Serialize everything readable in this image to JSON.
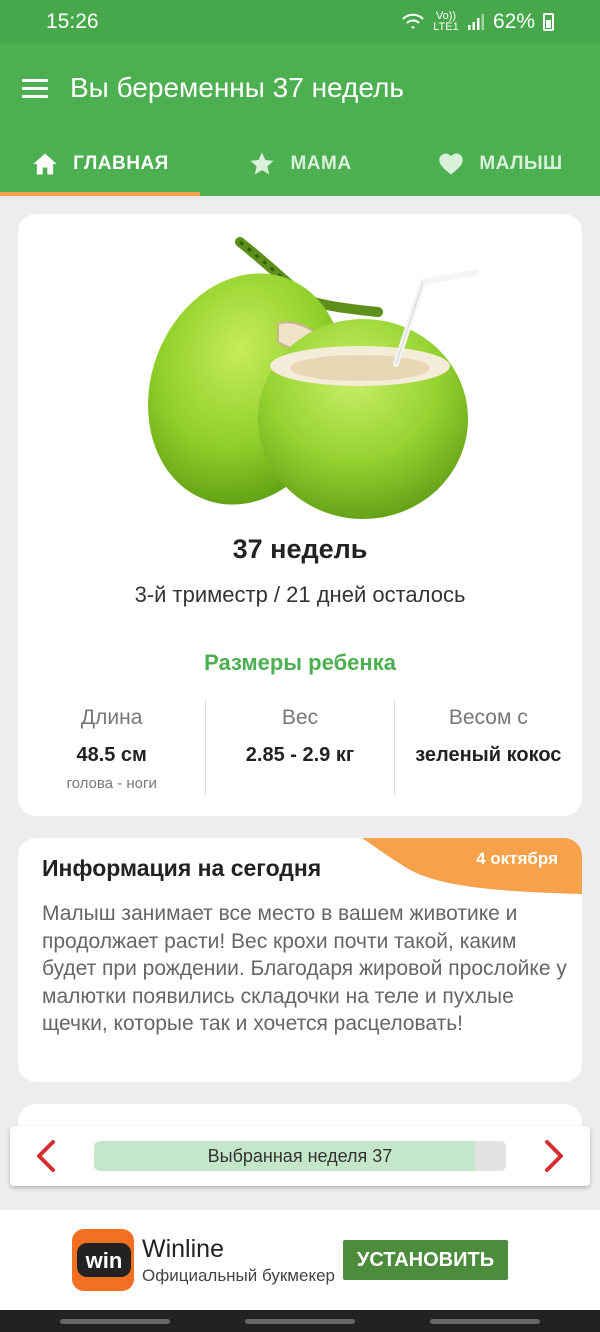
{
  "status": {
    "time": "15:26",
    "network": "Vo)) LTE1",
    "battery": "62%"
  },
  "header": {
    "title": "Вы беременны 37 недель"
  },
  "tabs": [
    {
      "label": "ГЛАВНАЯ",
      "icon": "home-icon",
      "active": true
    },
    {
      "label": "МАМА",
      "icon": "star-icon",
      "active": false
    },
    {
      "label": "МАЛЫШ",
      "icon": "heart-icon",
      "active": false
    }
  ],
  "main_card": {
    "image": "coconut",
    "week": "37 недель",
    "trimester": "3-й триместр / 21 дней осталось",
    "sizes_title": "Размеры ребенка",
    "metrics": [
      {
        "label": "Длина",
        "value": "48.5 см",
        "sub": "голова - ноги"
      },
      {
        "label": "Вес",
        "value": "2.85 - 2.9 кг",
        "sub": ""
      },
      {
        "label": "Весом с",
        "value": "зеленый кокос",
        "sub": ""
      }
    ]
  },
  "info_card": {
    "title": "Информация на сегодня",
    "date": "4 октября",
    "text": "Малыш занимает все место в вашем животике и продолжает расти! Вес крохи почти такой, каким будет при рождении. Благодаря жировой прослойке у малютки появились складочки на теле и пухлые щечки, которые так и хочется расцеловать!"
  },
  "week_selector": {
    "label": "Выбранная неделя 37",
    "progress": 0.925
  },
  "ad": {
    "name": "Winline",
    "description": "Официальный букмекер",
    "button": "УСТАНОВИТЬ",
    "logo_text": "win"
  },
  "colors": {
    "primary": "#4caf50",
    "status_bar": "#46a84a",
    "accent": "#f7a14a",
    "arrow": "#d32f2f",
    "ad_button": "#4c8c3c"
  }
}
